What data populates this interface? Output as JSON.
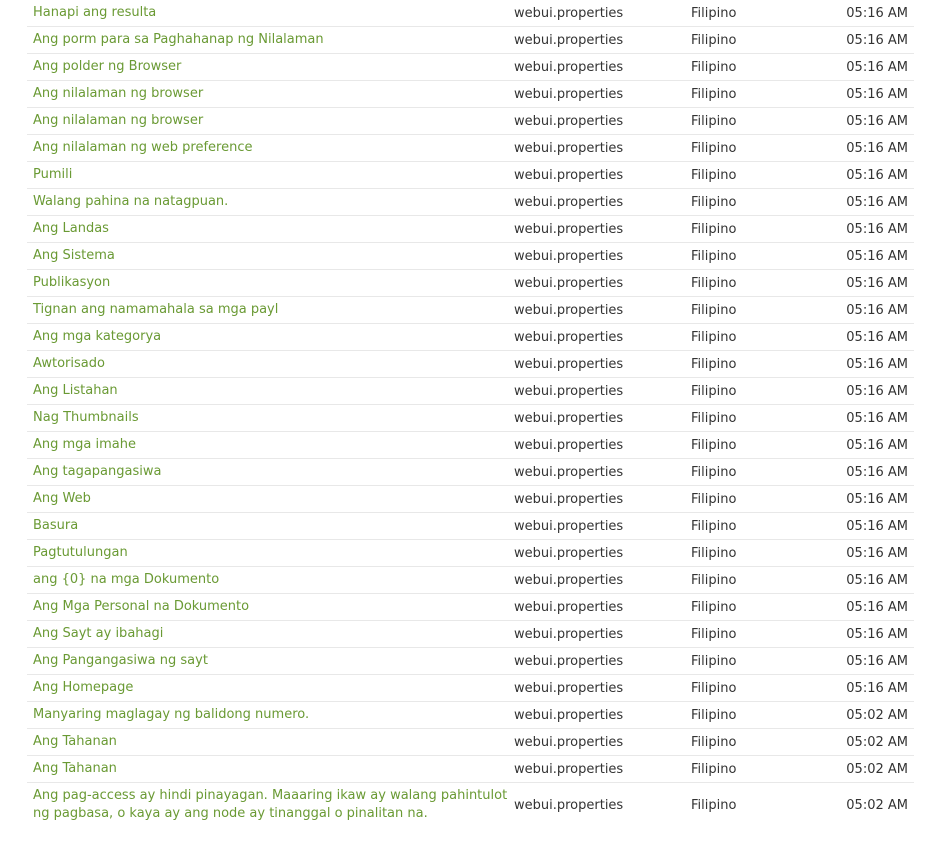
{
  "rows": [
    {
      "text": "Hanapi ang resulta",
      "file": "webui.properties",
      "language": "Filipino",
      "time": "05:16 AM"
    },
    {
      "text": "Ang porm para sa Paghahanap ng Nilalaman",
      "file": "webui.properties",
      "language": "Filipino",
      "time": "05:16 AM"
    },
    {
      "text": "Ang polder ng Browser",
      "file": "webui.properties",
      "language": "Filipino",
      "time": "05:16 AM"
    },
    {
      "text": "Ang nilalaman ng browser",
      "file": "webui.properties",
      "language": "Filipino",
      "time": "05:16 AM"
    },
    {
      "text": "Ang nilalaman ng browser",
      "file": "webui.properties",
      "language": "Filipino",
      "time": "05:16 AM"
    },
    {
      "text": "Ang nilalaman ng web preference",
      "file": "webui.properties",
      "language": "Filipino",
      "time": "05:16 AM"
    },
    {
      "text": "Pumili",
      "file": "webui.properties",
      "language": "Filipino",
      "time": "05:16 AM"
    },
    {
      "text": "Walang pahina na natagpuan.",
      "file": "webui.properties",
      "language": "Filipino",
      "time": "05:16 AM"
    },
    {
      "text": "Ang Landas",
      "file": "webui.properties",
      "language": "Filipino",
      "time": "05:16 AM"
    },
    {
      "text": "Ang Sistema",
      "file": "webui.properties",
      "language": "Filipino",
      "time": "05:16 AM"
    },
    {
      "text": "Publikasyon",
      "file": "webui.properties",
      "language": "Filipino",
      "time": "05:16 AM"
    },
    {
      "text": "Tignan ang namamahala sa mga payl",
      "file": "webui.properties",
      "language": "Filipino",
      "time": "05:16 AM"
    },
    {
      "text": "Ang mga kategorya",
      "file": "webui.properties",
      "language": "Filipino",
      "time": "05:16 AM"
    },
    {
      "text": "Awtorisado",
      "file": "webui.properties",
      "language": "Filipino",
      "time": "05:16 AM"
    },
    {
      "text": "Ang Listahan",
      "file": "webui.properties",
      "language": "Filipino",
      "time": "05:16 AM"
    },
    {
      "text": "Nag Thumbnails",
      "file": "webui.properties",
      "language": "Filipino",
      "time": "05:16 AM"
    },
    {
      "text": "Ang mga imahe",
      "file": "webui.properties",
      "language": "Filipino",
      "time": "05:16 AM"
    },
    {
      "text": "Ang tagapangasiwa",
      "file": "webui.properties",
      "language": "Filipino",
      "time": "05:16 AM"
    },
    {
      "text": "Ang Web",
      "file": "webui.properties",
      "language": "Filipino",
      "time": "05:16 AM"
    },
    {
      "text": "Basura",
      "file": "webui.properties",
      "language": "Filipino",
      "time": "05:16 AM"
    },
    {
      "text": "Pagtutulungan",
      "file": "webui.properties",
      "language": "Filipino",
      "time": "05:16 AM"
    },
    {
      "text": "ang {0} na mga Dokumento",
      "file": "webui.properties",
      "language": "Filipino",
      "time": "05:16 AM"
    },
    {
      "text": "Ang Mga Personal na Dokumento",
      "file": "webui.properties",
      "language": "Filipino",
      "time": "05:16 AM"
    },
    {
      "text": "Ang Sayt ay ibahagi",
      "file": "webui.properties",
      "language": "Filipino",
      "time": "05:16 AM"
    },
    {
      "text": "Ang Pangangasiwa ng sayt",
      "file": "webui.properties",
      "language": "Filipino",
      "time": "05:16 AM"
    },
    {
      "text": "Ang Homepage",
      "file": "webui.properties",
      "language": "Filipino",
      "time": "05:16 AM"
    },
    {
      "text": "Manyaring maglagay ng balidong numero.",
      "file": "webui.properties",
      "language": "Filipino",
      "time": "05:02 AM"
    },
    {
      "text": "Ang Tahanan",
      "file": "webui.properties",
      "language": "Filipino",
      "time": "05:02 AM"
    },
    {
      "text": "Ang Tahanan",
      "file": "webui.properties",
      "language": "Filipino",
      "time": "05:02 AM"
    },
    {
      "text": "Ang pag-access ay hindi pinayagan. Maaaring ikaw ay walang pahintulot ng pagbasa, o kaya ay ang node ay tinanggal o pinalitan na.",
      "file": "webui.properties",
      "language": "Filipino",
      "time": "05:02 AM"
    }
  ],
  "colors": {
    "link": "#6a9a34",
    "text": "#333333",
    "divider": "#e8e8e8"
  }
}
